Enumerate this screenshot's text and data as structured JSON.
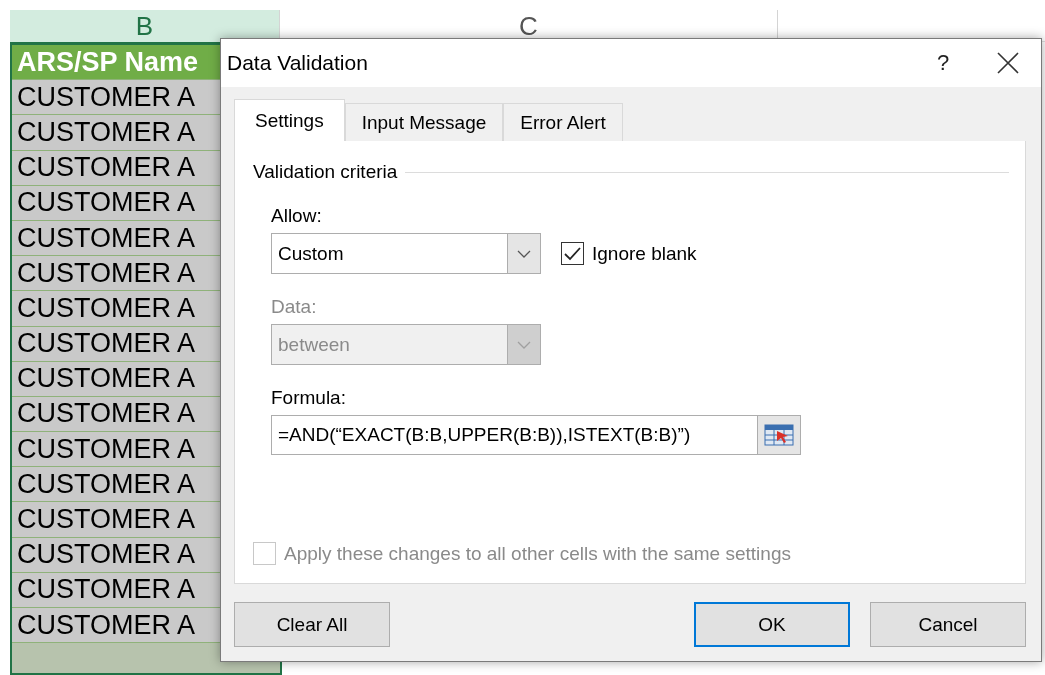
{
  "sheet": {
    "columns": [
      {
        "label": "B",
        "selected": true
      },
      {
        "label": "C",
        "selected": false
      }
    ],
    "header_cell": "ARS/SP Name",
    "rows": [
      "CUSTOMER A",
      "CUSTOMER A",
      "CUSTOMER A",
      "CUSTOMER A",
      "CUSTOMER A",
      "CUSTOMER A",
      "CUSTOMER A",
      "CUSTOMER A",
      "CUSTOMER A",
      "CUSTOMER A",
      "CUSTOMER A",
      "CUSTOMER A",
      "CUSTOMER A",
      "CUSTOMER A",
      "CUSTOMER A",
      "CUSTOMER A"
    ]
  },
  "dialog": {
    "title": "Data Validation",
    "help": "?",
    "tabs": [
      {
        "label": "Settings",
        "selected": true
      },
      {
        "label": "Input Message",
        "selected": false
      },
      {
        "label": "Error Alert",
        "selected": false
      }
    ],
    "section_title": "Validation criteria",
    "allow": {
      "label": "Allow:",
      "value": "Custom",
      "disabled": false
    },
    "ignore_blank": {
      "label": "Ignore blank",
      "checked": true,
      "disabled": false
    },
    "data": {
      "label": "Data:",
      "value": "between",
      "disabled": true
    },
    "formula": {
      "label": "Formula:",
      "value": "=AND(“EXACT(B:B,UPPER(B:B)),ISTEXT(B:B)”)"
    },
    "apply_all": {
      "label": "Apply these changes to all other cells with the same settings",
      "checked": false,
      "disabled": true
    },
    "buttons": [
      {
        "label": "Clear All",
        "kind": "secondary"
      },
      {
        "label": "OK",
        "kind": "default"
      },
      {
        "label": "Cancel",
        "kind": "secondary"
      }
    ]
  }
}
